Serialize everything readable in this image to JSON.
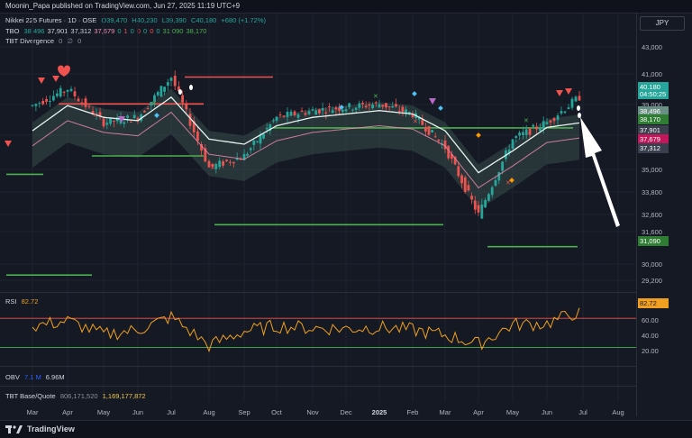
{
  "header": {
    "publisher_text": "Moonin_Papa published on TradingView.com, Jun 27, 2025 11:19 UTC+9"
  },
  "legend": {
    "symbol": "Nikkei 225 Futures · 1D · OSE",
    "ohlc": {
      "o": "O39,470",
      "h": "H40,230",
      "l": "L39,390",
      "c": "C40,180",
      "chg": "+680 (+1.72%)"
    },
    "tbo_label": "TBO",
    "tbo_values": [
      "38,496",
      "37,901",
      "37,312",
      "37,679",
      "0",
      "1",
      "0",
      "0",
      "0",
      "0",
      "0",
      "31,090",
      "38,170"
    ],
    "divergence_label": "TBT Divergence",
    "divergence_values": [
      "0",
      "∅",
      "0"
    ]
  },
  "currency_button": "JPY",
  "price_axis": {
    "ticks": [
      "43,000",
      "41,000",
      "39,000",
      "37,000",
      "35,000",
      "33,800",
      "32,600",
      "31,600",
      "30,000",
      "29,200"
    ],
    "badges": [
      {
        "text": "40,180",
        "color": "#26a69a"
      },
      {
        "text": "04:50:25",
        "color": "#26a69a"
      },
      {
        "text": "38,496",
        "color": "#6a8f84"
      },
      {
        "text": "38,170",
        "color": "#2e7d32"
      },
      {
        "text": "37,901",
        "color": "#3a3f4d"
      },
      {
        "text": "37,679",
        "color": "#c2185b"
      },
      {
        "text": "37,312",
        "color": "#3a3f4d"
      },
      {
        "text": "31,090",
        "color": "#2e7d32"
      }
    ]
  },
  "rsi": {
    "label": "RSI",
    "value": "82.72",
    "ticks": [
      "80.00",
      "60.00",
      "40.00",
      "20.00"
    ],
    "badge": "82.72"
  },
  "obv": {
    "label": "OBV",
    "v1": "7.1 M",
    "v2": "6.96M"
  },
  "tbt": {
    "label": "TBT Base/Quote",
    "v1": "806,171,520",
    "v2": "1,169,177,872"
  },
  "time_axis": [
    "Mar",
    "Apr",
    "May",
    "Jun",
    "Jul",
    "Aug",
    "Sep",
    "Oct",
    "Nov",
    "Dec",
    "2025",
    "Feb",
    "Mar",
    "Apr",
    "May",
    "Jun",
    "Jul",
    "Aug"
  ],
  "footer": {
    "brand": "TradingView"
  },
  "colors": {
    "up": "#26a69a",
    "down": "#ef5350",
    "background": "#151924",
    "rsi_line": "#f0a020",
    "ma_line": "#e8f4f0",
    "pink_ma": "#f48fb1"
  },
  "chart_data": {
    "type": "line",
    "title": "Nikkei 225 Futures · 1D · OSE",
    "xlabel": "",
    "ylabel": "",
    "x": [
      "Mar",
      "Apr",
      "May",
      "Jun",
      "Jul",
      "Aug",
      "Sep",
      "Oct",
      "Nov",
      "Dec",
      "2025",
      "Feb",
      "Mar",
      "Apr",
      "May",
      "Jun",
      "Jul",
      "Aug"
    ],
    "ylim": [
      28500,
      43500
    ],
    "grid": true,
    "series": [
      {
        "name": "price",
        "values": [
          39500,
          40500,
          38500,
          38800,
          41200,
          35800,
          36500,
          38800,
          39200,
          39400,
          39600,
          39000,
          37000,
          33000,
          37500,
          38500,
          40180,
          null
        ]
      },
      {
        "name": "TBO",
        "values": [
          38000,
          39500,
          38800,
          38600,
          40000,
          37500,
          37200,
          38300,
          38800,
          39000,
          39200,
          39000,
          38000,
          35500,
          36800,
          38200,
          38496,
          null
        ]
      }
    ],
    "levels": [
      {
        "name": "",
        "value": 41200,
        "color": "#ef5350"
      },
      {
        "name": "",
        "value": 31090,
        "color": "#4caf50"
      },
      {
        "name": "",
        "value": 38170,
        "color": "#4caf50"
      },
      {
        "name": "",
        "value": 32400,
        "color": "#4caf50"
      },
      {
        "name": "",
        "value": 29400,
        "color": "#4caf50"
      }
    ],
    "rsi": {
      "ylim": [
        0,
        100
      ],
      "overbought": 70,
      "oversold": 25,
      "last": 82.72
    }
  }
}
